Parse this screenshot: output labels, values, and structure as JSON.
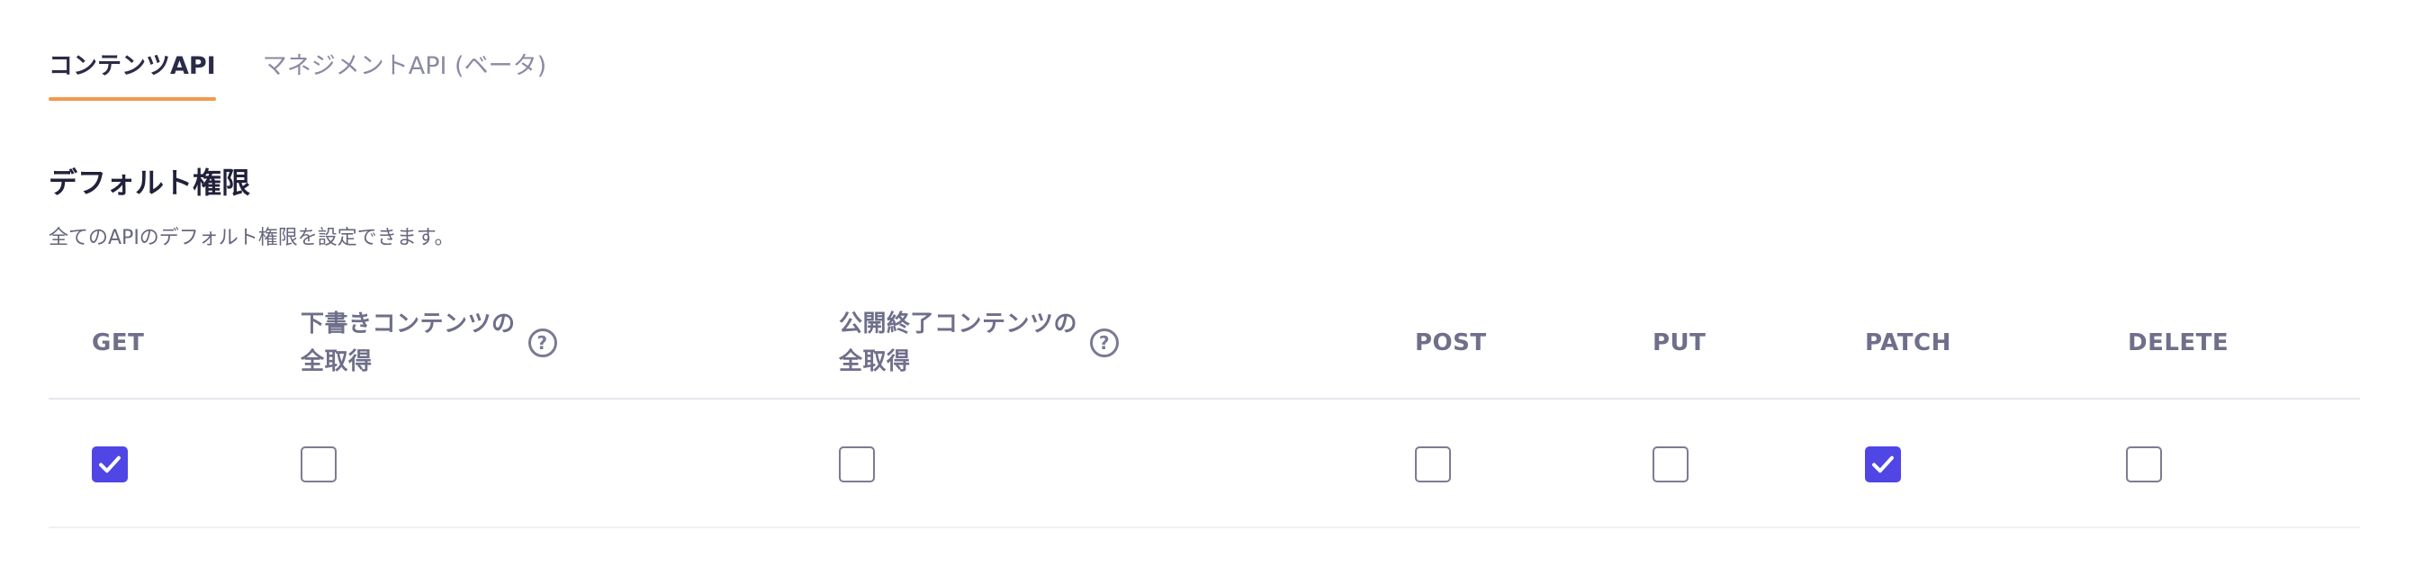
{
  "tabs": [
    {
      "label": "コンテンツAPI",
      "active": true
    },
    {
      "label": "マネジメントAPI (ベータ)",
      "active": false
    }
  ],
  "section": {
    "title": "デフォルト権限",
    "description": "全てのAPIのデフォルト権限を設定できます。"
  },
  "permissions": {
    "columns": [
      {
        "label": "GET",
        "help": false,
        "checked": true
      },
      {
        "label_line1": "下書きコンテンツの",
        "label_line2": "全取得",
        "help": true,
        "checked": false
      },
      {
        "label_line1": "公開終了コンテンツの",
        "label_line2": "全取得",
        "help": true,
        "checked": false
      },
      {
        "label": "POST",
        "help": false,
        "checked": false
      },
      {
        "label": "PUT",
        "help": false,
        "checked": false
      },
      {
        "label": "PATCH",
        "help": false,
        "checked": true
      },
      {
        "label": "DELETE",
        "help": false,
        "checked": false
      }
    ],
    "help_glyph": "?"
  },
  "colors": {
    "accent": "#5046e5",
    "tab_underline": "#f2994a"
  }
}
